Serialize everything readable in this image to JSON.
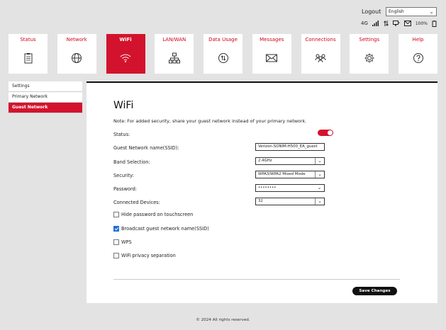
{
  "header": {
    "logout_label": "Logout",
    "language": "English",
    "status_bar": {
      "network_type": "4G",
      "battery_percent": "100%"
    }
  },
  "nav": {
    "tabs": [
      {
        "label": "Status",
        "icon": "clipboard-icon"
      },
      {
        "label": "Network",
        "icon": "globe-icon"
      },
      {
        "label": "WiFi",
        "icon": "wifi-icon",
        "active": true
      },
      {
        "label": "LAN/WAN",
        "icon": "network-tree-icon"
      },
      {
        "label": "Data Usage",
        "icon": "data-usage-icon"
      },
      {
        "label": "Messages",
        "icon": "envelope-icon"
      },
      {
        "label": "Connections",
        "icon": "users-icon"
      },
      {
        "label": "Settings",
        "icon": "gear-icon"
      },
      {
        "label": "Help",
        "icon": "question-icon"
      }
    ]
  },
  "sidebar": {
    "items": [
      {
        "label": "Settings"
      },
      {
        "label": "Primary Network"
      },
      {
        "label": "Guest Network",
        "active": true
      }
    ]
  },
  "main": {
    "title": "WiFi",
    "note": "Note: For added security, share your guest network instead of your primary network.",
    "status_label": "Status:",
    "status_on": true,
    "ssid_label": "Guest Network name(SSID):",
    "ssid_value": "Verizon-SONIM-H500_EA_guest",
    "band_label": "Band Selection:",
    "band_value": "2.4GHz",
    "security_label": "Security:",
    "security_value": "WPA3/WPA2 Mixed Mode",
    "password_label": "Password:",
    "password_value": "••••••••",
    "devices_label": "Connected Devices:",
    "devices_value": "32",
    "checkboxes": [
      {
        "label": "Hide password on touchscreen",
        "checked": false
      },
      {
        "label": "Broadcast guest network name(SSID)",
        "checked": true
      },
      {
        "label": "WPS",
        "checked": false
      },
      {
        "label": "WiFi privacy separation",
        "checked": false
      }
    ],
    "save_label": "Save Changes"
  },
  "footer": {
    "copyright": "© 2024 All rights reserved."
  },
  "colors": {
    "accent": "#d3132d",
    "checkbox": "#1f6fd1",
    "background": "#e3e3e3"
  }
}
